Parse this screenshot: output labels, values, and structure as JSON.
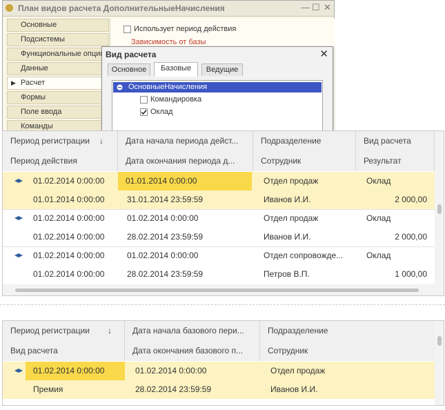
{
  "window": {
    "title": "План видов расчета ДополнительныеНачисления",
    "controls": [
      "—",
      "☐",
      "✕"
    ],
    "nav": [
      "Основные",
      "Подсистемы",
      "Функциональные опции",
      "Данные",
      "Расчет",
      "Формы",
      "Поле ввода",
      "Команды"
    ],
    "active_nav": "Расчет",
    "uses_period_label": "Использует период действия",
    "base_dependency_label": "Зависимость от базы"
  },
  "dialog": {
    "title": "Вид расчета",
    "close": "✕",
    "tabs": [
      "Основное",
      "Базовые",
      "Ведущие"
    ],
    "selected_tab": "Базовые",
    "tree": {
      "root": "ОсновныеНачисления",
      "items": [
        {
          "label": "Командировка",
          "checked": false
        },
        {
          "label": "Оклад",
          "checked": true
        }
      ]
    }
  },
  "table1": {
    "headers_row1": [
      "Период регистрации",
      "Дата начала периода дейст...",
      "Подразделение",
      "Вид расчета"
    ],
    "headers_row2": [
      "Период действия",
      "Дата окончания периода д...",
      "Сотрудник",
      "Результат"
    ],
    "sort_arrow": "↓",
    "records": [
      {
        "line1": [
          "01.02.2014 0:00:00",
          "01.01.2014 0:00:00",
          "Отдел продаж",
          "Оклад"
        ],
        "line2": [
          "01.01.2014 0:00:00",
          "31.01.2014 23:59:59",
          "Иванов И.И.",
          "2 000,00"
        ]
      },
      {
        "line1": [
          "01.02.2014 0:00:00",
          "01.02.2014 0:00:00",
          "Отдел продаж",
          "Оклад"
        ],
        "line2": [
          "01.02.2014 0:00:00",
          "28.02.2014 23:59:59",
          "Иванов И.И.",
          "2 000,00"
        ]
      },
      {
        "line1": [
          "01.02.2014 0:00:00",
          "01.02.2014 0:00:00",
          "Отдел сопровожде...",
          "Оклад"
        ],
        "line2": [
          "01.02.2014 0:00:00",
          "28.02.2014 23:59:59",
          "Петров В.П.",
          "1 000,00"
        ]
      }
    ]
  },
  "table2": {
    "headers_row1": [
      "Период регистрации",
      "Дата начала базового пери...",
      "Подразделение"
    ],
    "headers_row2": [
      "Вид расчета",
      "Дата окончания базового п...",
      "Сотрудник"
    ],
    "sort_arrow": "↓",
    "records": [
      {
        "line1": [
          "01.02.2014 0:00:00",
          "01.02.2014 0:00:00",
          "Отдел продаж"
        ],
        "line2": [
          "Премия",
          "28.02.2014 23:59:59",
          "Иванов И.И."
        ]
      }
    ]
  },
  "colors": {
    "selected_row": "#fdf3c2",
    "current_cell": "#f9d94a",
    "row_icon": "#2f5f9e",
    "tree_selection": "#3d56c4"
  },
  "icons": [
    "app-icon",
    "row-record-icon",
    "sort-down-icon",
    "close-icon",
    "expand-icon",
    "checkbox-icon"
  ]
}
